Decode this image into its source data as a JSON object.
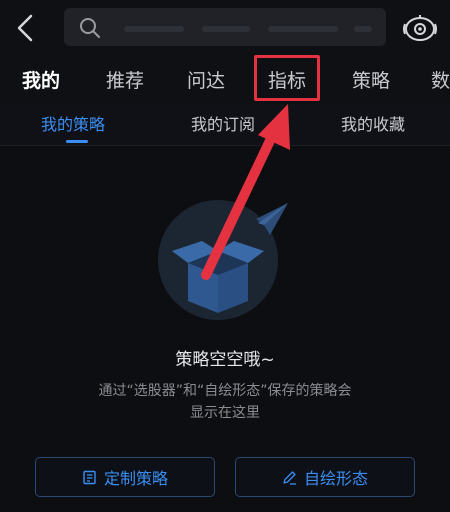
{
  "main_tabs": [
    "我的",
    "推荐",
    "问达",
    "指标",
    "策略",
    "数"
  ],
  "sub_tabs": [
    "我的策略",
    "我的订阅",
    "我的收藏"
  ],
  "empty_state": {
    "title": "策略空空哦~",
    "desc_line1": "通过“选股器”和“自绘形态”保存的策略会",
    "desc_line2": "显示在这里"
  },
  "buttons": {
    "custom_strategy": "定制策略",
    "draw_pattern": "自绘形态"
  },
  "colors": {
    "accent_blue": "#3a8ef3",
    "highlight_red": "#e53241"
  }
}
